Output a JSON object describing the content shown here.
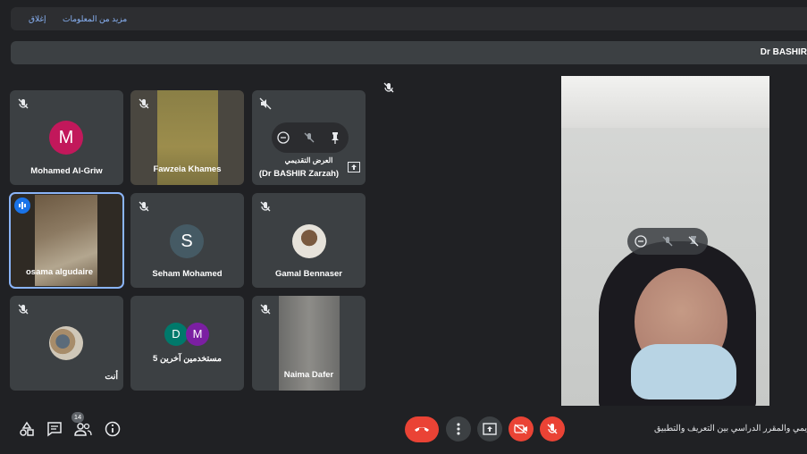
{
  "banner": {
    "close_label": "إغلاق",
    "more_info_label": "مزيد من المعلومات"
  },
  "presenter_name": "Dr BASHIR",
  "participants": [
    {
      "name": "Mohamed Al-Griw",
      "initial": "M",
      "avatar_color": "#c2185b"
    },
    {
      "name": "Fawzeia Khames"
    },
    {
      "name_line1": "العرض التقديمي",
      "name_line2": "(Dr BASHIR Zarzah)"
    },
    {
      "name": "osama algudaire"
    },
    {
      "name": "Seham Mohamed",
      "initial": "S",
      "avatar_color": "#455a64"
    },
    {
      "name": "Gamal Bennaser"
    },
    {
      "name": "أنت"
    },
    {
      "name": "5 مستخدمين آخرين",
      "initials": [
        "D",
        "M"
      ],
      "avatar_colors": [
        "#00796b",
        "#7b1fa2"
      ]
    },
    {
      "name": "Naima Dafer"
    }
  ],
  "toolbar": {
    "people_count": "14",
    "meeting_title": "يمي والمقرر الدراسي بين التعريف والتطبيق"
  },
  "colors": {
    "accent": "#8ab4f8",
    "danger": "#ea4335",
    "bg": "#202124",
    "tile": "#3c4043"
  }
}
